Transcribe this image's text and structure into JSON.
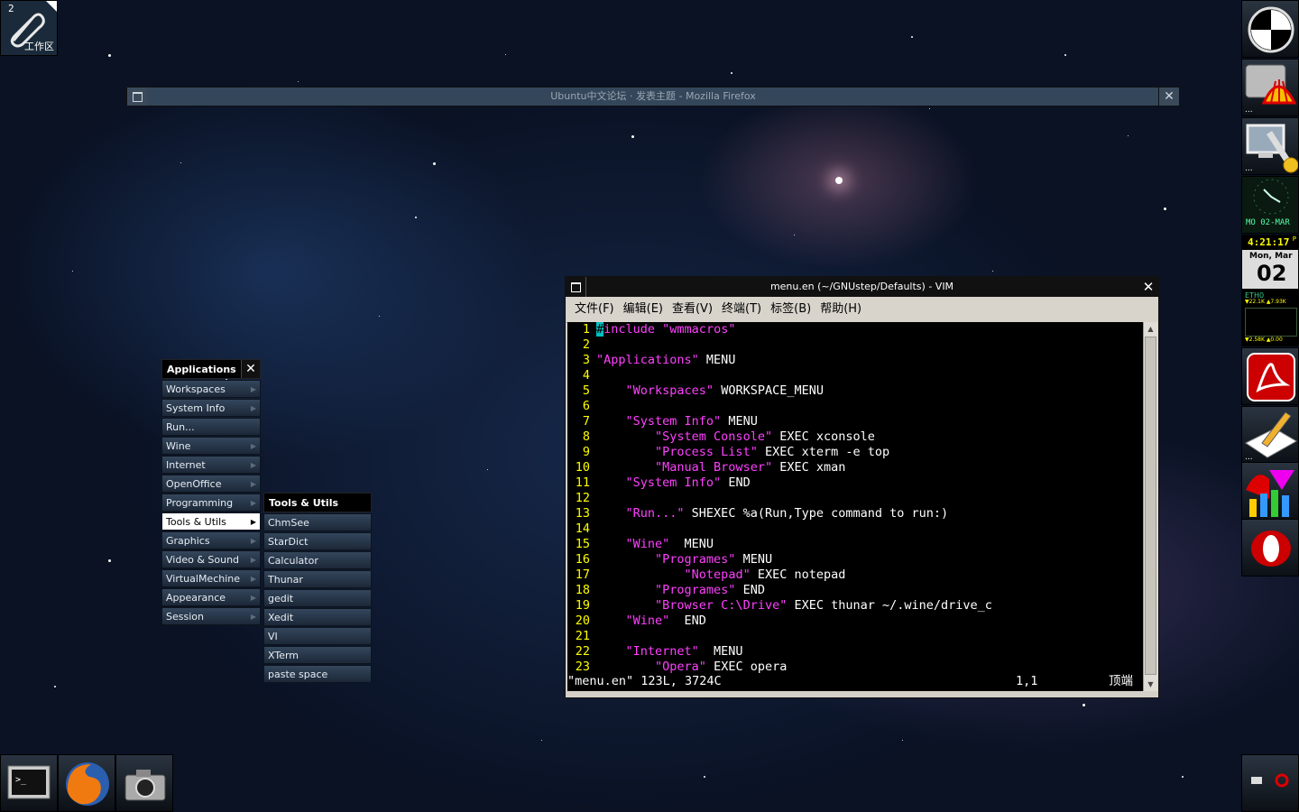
{
  "workspace": {
    "number": "2",
    "name": "工作区"
  },
  "firefox_window": {
    "title": "Ubuntu中文论坛 · 发表主题 - Mozilla Firefox"
  },
  "vim": {
    "title": "menu.en (~/GNUstep/Defaults) - VIM",
    "menus": [
      "文件(F)",
      "编辑(E)",
      "查看(V)",
      "终端(T)",
      "标签(B)",
      "帮助(H)"
    ],
    "lines": [
      {
        "n": "1",
        "parts": [
          {
            "t": "#",
            "c": "cur"
          },
          {
            "t": "include ",
            "c": "k"
          },
          {
            "t": "\"wmmacros\"",
            "c": "k"
          }
        ]
      },
      {
        "n": "2",
        "parts": []
      },
      {
        "n": "3",
        "parts": [
          {
            "t": "\"Applications\"",
            "c": "k"
          },
          {
            "t": " MENU",
            "c": ""
          }
        ]
      },
      {
        "n": "4",
        "parts": []
      },
      {
        "n": "5",
        "parts": [
          {
            "t": "    ",
            "c": ""
          },
          {
            "t": "\"Workspaces\"",
            "c": "k"
          },
          {
            "t": " WORKSPACE_MENU",
            "c": ""
          }
        ]
      },
      {
        "n": "6",
        "parts": []
      },
      {
        "n": "7",
        "parts": [
          {
            "t": "    ",
            "c": ""
          },
          {
            "t": "\"System Info\"",
            "c": "k"
          },
          {
            "t": " MENU",
            "c": ""
          }
        ]
      },
      {
        "n": "8",
        "parts": [
          {
            "t": "        ",
            "c": ""
          },
          {
            "t": "\"System Console\"",
            "c": "k"
          },
          {
            "t": " EXEC xconsole",
            "c": ""
          }
        ]
      },
      {
        "n": "9",
        "parts": [
          {
            "t": "        ",
            "c": ""
          },
          {
            "t": "\"Process List\"",
            "c": "k"
          },
          {
            "t": " EXEC xterm -e top",
            "c": ""
          }
        ]
      },
      {
        "n": "10",
        "parts": [
          {
            "t": "        ",
            "c": ""
          },
          {
            "t": "\"Manual Browser\"",
            "c": "k"
          },
          {
            "t": " EXEC xman",
            "c": ""
          }
        ]
      },
      {
        "n": "11",
        "parts": [
          {
            "t": "    ",
            "c": ""
          },
          {
            "t": "\"System Info\"",
            "c": "k"
          },
          {
            "t": " END",
            "c": ""
          }
        ]
      },
      {
        "n": "12",
        "parts": []
      },
      {
        "n": "13",
        "parts": [
          {
            "t": "    ",
            "c": ""
          },
          {
            "t": "\"Run...\"",
            "c": "k"
          },
          {
            "t": " SHEXEC %a(Run,Type command to run:)",
            "c": ""
          }
        ]
      },
      {
        "n": "14",
        "parts": []
      },
      {
        "n": "15",
        "parts": [
          {
            "t": "    ",
            "c": ""
          },
          {
            "t": "\"Wine\"",
            "c": "k"
          },
          {
            "t": "  MENU",
            "c": ""
          }
        ]
      },
      {
        "n": "16",
        "parts": [
          {
            "t": "        ",
            "c": ""
          },
          {
            "t": "\"Programes\"",
            "c": "k"
          },
          {
            "t": " MENU",
            "c": ""
          }
        ]
      },
      {
        "n": "17",
        "parts": [
          {
            "t": "            ",
            "c": ""
          },
          {
            "t": "\"Notepad\"",
            "c": "k"
          },
          {
            "t": " EXEC notepad",
            "c": ""
          }
        ]
      },
      {
        "n": "18",
        "parts": [
          {
            "t": "        ",
            "c": ""
          },
          {
            "t": "\"Programes\"",
            "c": "k"
          },
          {
            "t": " END",
            "c": ""
          }
        ]
      },
      {
        "n": "19",
        "parts": [
          {
            "t": "        ",
            "c": ""
          },
          {
            "t": "\"Browser C:\\Drive\"",
            "c": "k"
          },
          {
            "t": " EXEC thunar ~/.wine/drive_c",
            "c": ""
          }
        ]
      },
      {
        "n": "20",
        "parts": [
          {
            "t": "    ",
            "c": ""
          },
          {
            "t": "\"Wine\"",
            "c": "k"
          },
          {
            "t": "  END",
            "c": ""
          }
        ]
      },
      {
        "n": "21",
        "parts": []
      },
      {
        "n": "22",
        "parts": [
          {
            "t": "    ",
            "c": ""
          },
          {
            "t": "\"Internet\"",
            "c": "k"
          },
          {
            "t": "  MENU",
            "c": ""
          }
        ]
      },
      {
        "n": "23",
        "parts": [
          {
            "t": "        ",
            "c": ""
          },
          {
            "t": "\"Opera\"",
            "c": "k"
          },
          {
            "t": " EXEC opera",
            "c": ""
          }
        ]
      }
    ],
    "status_file": "\"menu.en\" 123L, 3724C",
    "status_pos": "1,1",
    "status_scroll": "顶端"
  },
  "applications_menu": {
    "title": "Applications",
    "items": [
      "Workspaces",
      "System Info",
      "Run...",
      "Wine",
      "Internet",
      "OpenOffice",
      "Programming",
      "Tools & Utils",
      "Graphics",
      "Video & Sound",
      "VirtualMechine",
      "Appearance",
      "Session"
    ],
    "arrows": [
      true,
      true,
      false,
      true,
      true,
      true,
      true,
      true,
      true,
      true,
      true,
      true,
      true
    ],
    "selected_index": 7
  },
  "tools_menu": {
    "title": "Tools & Utils",
    "items": [
      "ChmSee",
      "StarDict",
      "Calculator",
      "Thunar",
      "gedit",
      "Xedit",
      "VI",
      "XTerm",
      "paste space"
    ]
  },
  "dock": {
    "clock_date": "MO 02-MAR",
    "time": "4:21:17",
    "time_suffix": "P",
    "date_day": "Mon, Mar",
    "date_num": "02",
    "net_iface": "ETH0",
    "net_up": "▼22.1K ▲7.93K",
    "net_down": "▼2.58K ▲0.00"
  }
}
